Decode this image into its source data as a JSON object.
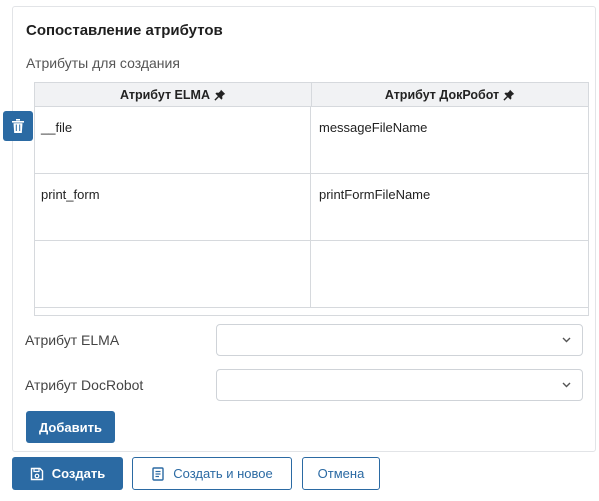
{
  "section": {
    "title": "Сопоставление атрибутов",
    "subtitle": "Атрибуты для создания"
  },
  "mapping_table": {
    "columns": [
      "Атрибут ELMA",
      "Атрибут ДокРобот"
    ],
    "rows": [
      [
        "__file",
        "messageFileName"
      ],
      [
        "print_form",
        "printFormFileName"
      ],
      [
        "",
        ""
      ]
    ]
  },
  "form": {
    "elma_label": "Атрибут ELMA",
    "elma_value": "",
    "docrobot_label": "Атрибут DocRobot",
    "docrobot_value": "",
    "add_label": "Добавить"
  },
  "footer": {
    "create_label": "Создать",
    "create_new_label": "Создать и новое",
    "cancel_label": "Отмена"
  },
  "colors": {
    "accent": "#2b6aa3",
    "border": "#d6d9dd",
    "header_bg": "#f1f2f4"
  },
  "icons": {
    "delete": "trash-icon",
    "column_pin": "pin-icon",
    "dropdown": "chevron-down-icon",
    "create": "save-icon",
    "create_new": "document-icon"
  }
}
